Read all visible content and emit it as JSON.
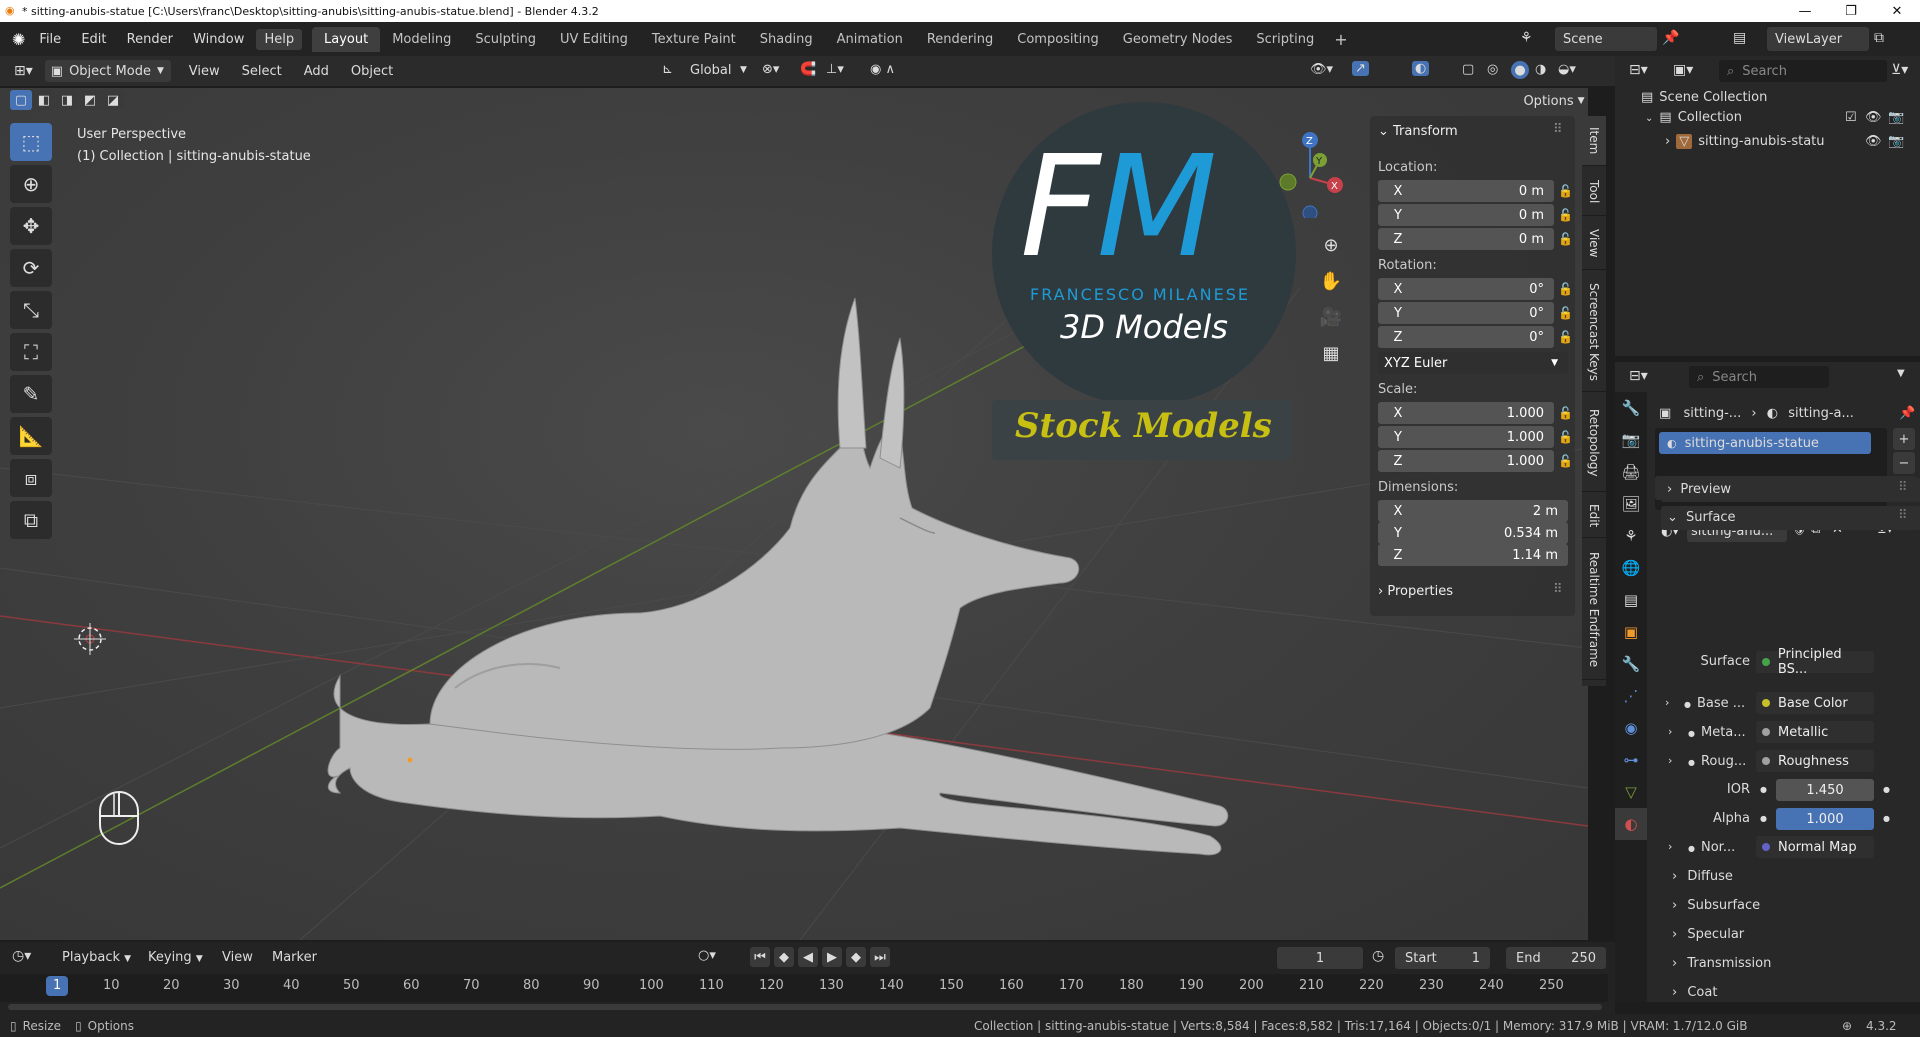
{
  "window": {
    "title": "* sitting-anubis-statue [C:\\Users\\franc\\Desktop\\sitting-anubis\\sitting-anubis-statue.blend] - Blender 4.3.2",
    "min": "—",
    "max": "❐",
    "close": "✕"
  },
  "menu": [
    "File",
    "Edit",
    "Render",
    "Window",
    "Help"
  ],
  "workspaces": [
    "Layout",
    "Modeling",
    "Sculpting",
    "UV Editing",
    "Texture Paint",
    "Shading",
    "Animation",
    "Rendering",
    "Compositing",
    "Geometry Nodes",
    "Scripting"
  ],
  "add_tab": "+",
  "scene": {
    "label": "Scene",
    "viewlayer": "ViewLayer"
  },
  "viewport_header": {
    "mode": "Object Mode",
    "menus": [
      "View",
      "Select",
      "Add",
      "Object"
    ],
    "orientation": "Global",
    "options": "Options"
  },
  "overlay": {
    "line1": "User Perspective",
    "line2": "(1) Collection | sitting-anubis-statue"
  },
  "logo": {
    "fm": "FM",
    "name": "FRANCESCO MILANESE",
    "sub": "3D Models",
    "stock": "Stock Models"
  },
  "gizmo": {
    "x": "X",
    "y": "Y",
    "z": "Z"
  },
  "transform": {
    "header": "Transform",
    "location_label": "Location:",
    "location": [
      {
        "a": "X",
        "v": "0 m"
      },
      {
        "a": "Y",
        "v": "0 m"
      },
      {
        "a": "Z",
        "v": "0 m"
      }
    ],
    "rotation_label": "Rotation:",
    "rotation": [
      {
        "a": "X",
        "v": "0°"
      },
      {
        "a": "Y",
        "v": "0°"
      },
      {
        "a": "Z",
        "v": "0°"
      }
    ],
    "rotation_mode": "XYZ Euler",
    "scale_label": "Scale:",
    "scale": [
      {
        "a": "X",
        "v": "1.000"
      },
      {
        "a": "Y",
        "v": "1.000"
      },
      {
        "a": "Z",
        "v": "1.000"
      }
    ],
    "dimensions_label": "Dimensions:",
    "dimensions": [
      {
        "a": "X",
        "v": "2 m"
      },
      {
        "a": "Y",
        "v": "0.534 m"
      },
      {
        "a": "Z",
        "v": "1.14 m"
      }
    ],
    "properties": "Properties"
  },
  "side_tabs": [
    "Item",
    "Tool",
    "View",
    "Screencast Keys",
    "Retopology",
    "Edit",
    "Realtime Endframe"
  ],
  "outliner": {
    "search": "Search",
    "scene_collection": "Scene Collection",
    "collection": "Collection",
    "object": "sitting-anubis-statu"
  },
  "properties": {
    "search": "Search",
    "breadcrumb": [
      "sitting-...",
      "sitting-a..."
    ],
    "slot": "sitting-anubis-statue",
    "material": "sitting-anu...",
    "preview": "Preview",
    "surface_header": "Surface",
    "surface_label": "Surface",
    "surface_value": "Principled BS...",
    "base_label": "Base ...",
    "base_value": "Base Color",
    "metal_label": "Meta...",
    "metal_value": "Metallic",
    "rough_label": "Roug...",
    "rough_value": "Roughness",
    "ior_label": "IOR",
    "ior_value": "1.450",
    "alpha_label": "Alpha",
    "alpha_value": "1.000",
    "normal_label": "Nor...",
    "normal_value": "Normal Map",
    "panels": [
      "Diffuse",
      "Subsurface",
      "Specular",
      "Transmission",
      "Coat"
    ]
  },
  "timeline": {
    "menus": [
      "Playback",
      "Keying",
      "View",
      "Marker"
    ],
    "current": "1",
    "start_label": "Start",
    "start": "1",
    "end_label": "End",
    "end": "250",
    "ticks": [
      "1",
      "10",
      "20",
      "30",
      "40",
      "50",
      "60",
      "70",
      "80",
      "90",
      "100",
      "110",
      "120",
      "130",
      "140",
      "150",
      "160",
      "170",
      "180",
      "190",
      "200",
      "210",
      "220",
      "230",
      "240",
      "250"
    ]
  },
  "status": {
    "resize": "Resize",
    "options": "Options",
    "info": "Collection | sitting-anubis-statue | Verts:8,584 | Faces:8,582 | Tris:17,164 | Objects:0/1 | Memory: 317.9 MiB | VRAM: 1.7/12.0 GiB",
    "version": "4.3.2"
  },
  "colors": {
    "accent": "#4772b3",
    "x_axis": "#c6414a",
    "y_axis": "#7ba135",
    "z_axis": "#3f74c4",
    "logo_blue": "#1e9ad6",
    "stock_yellow": "#c7c012"
  }
}
